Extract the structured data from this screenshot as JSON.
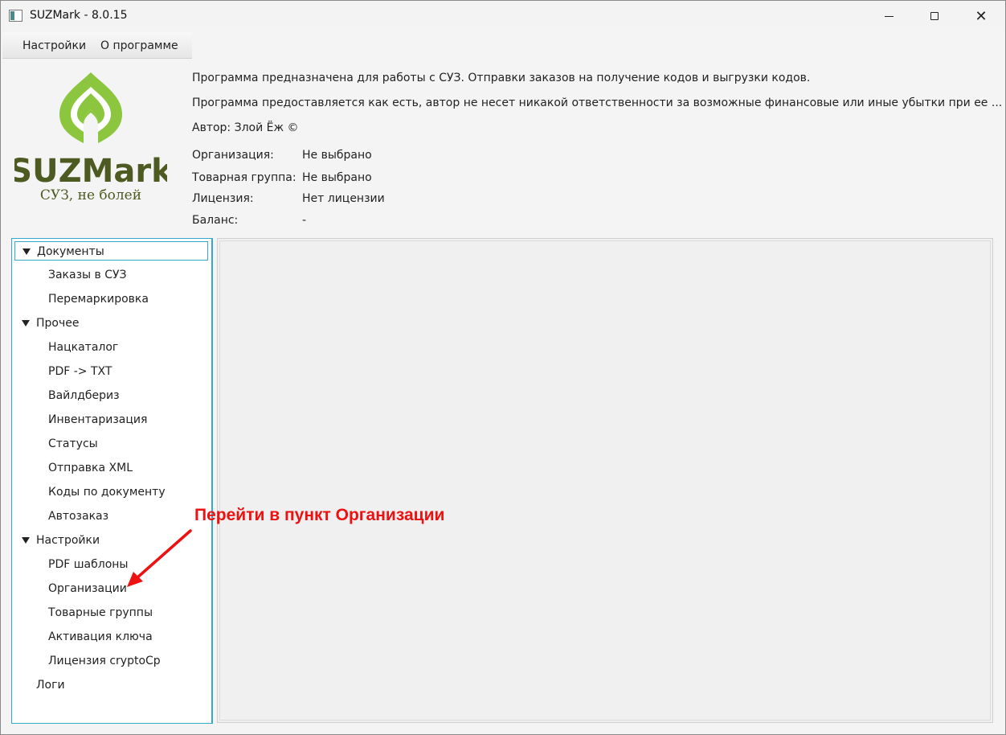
{
  "window": {
    "title": "SUZMark - 8.0.15"
  },
  "menu": {
    "settings": "Настройки",
    "about": "О программе"
  },
  "logo": {
    "name": "SUZMark",
    "tagline": "СУЗ, не болей",
    "colors": {
      "brand_green": "#8cc63e",
      "text_dark": "#4d5b22"
    }
  },
  "header": {
    "description": "Программа предназначена для работы с СУЗ. Отправки заказов на получение кодов и выгрузки кодов.",
    "disclaimer": "Программа предоставляется как есть, автор не несет никакой ответственности за возможные финансовые или иные убытки при ее ...",
    "author": "Автор: Злой Ёж ©"
  },
  "info": {
    "organization_label": "Организация:",
    "organization_value": "Не выбрано",
    "product_group_label": "Товарная группа:",
    "product_group_value": "Не выбрано",
    "license_label": "Лицензия:",
    "license_value": "Нет лицензии",
    "balance_label": "Баланс:",
    "balance_value": "-"
  },
  "tree": {
    "documents": "Документы",
    "orders": "Заказы в СУЗ",
    "remarking": "Перемаркировка",
    "other": "Прочее",
    "natcatalog": "Нацкаталог",
    "pdf_txt": "PDF -> TXT",
    "wildberries": "Вайлдбериз",
    "inventory": "Инвентаризация",
    "statuses": "Статусы",
    "send_xml": "Отправка XML",
    "codes_by_doc": "Коды по документу",
    "autoorder": "Автозаказ",
    "settings": "Настройки",
    "pdf_templates": "PDF шаблоны",
    "organizations": "Организации",
    "product_groups": "Товарные группы",
    "key_activation": "Активация ключа",
    "cryptocp_license": "Лицензия cryptoCp",
    "logs": "Логи"
  },
  "annotation": {
    "text": "Перейти в пункт Организации",
    "color": "#ee1111"
  },
  "colors": {
    "accent": "#33aacc"
  }
}
